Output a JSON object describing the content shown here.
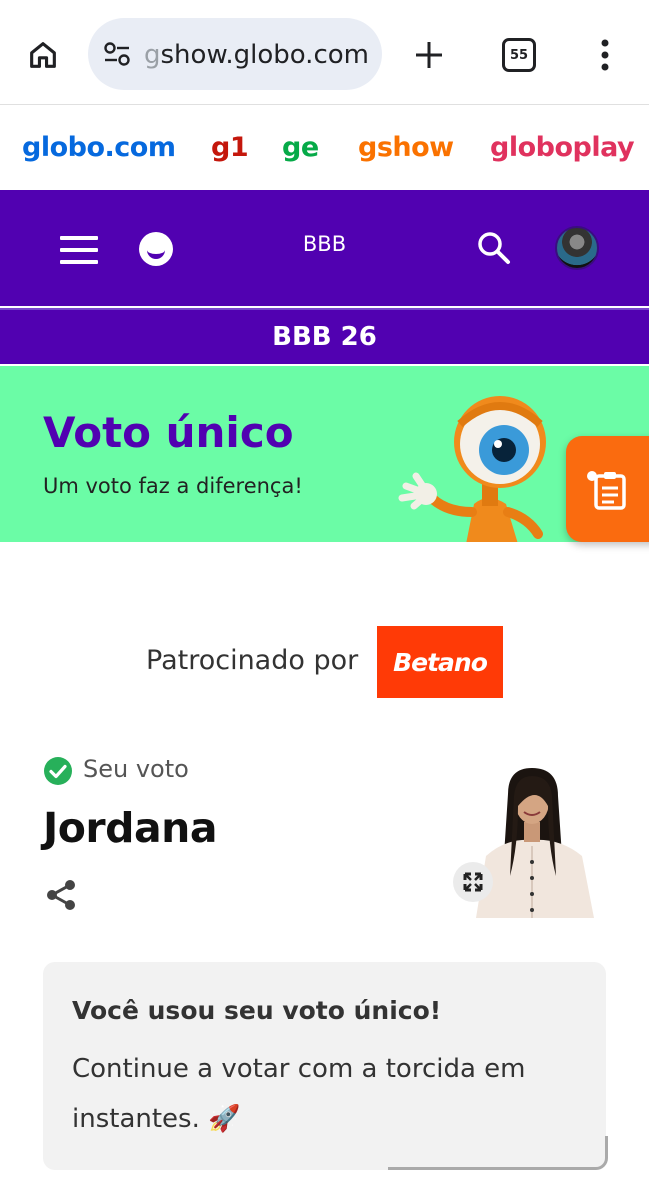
{
  "browser": {
    "url_faded": "g",
    "url": "show.globo.com",
    "tab_count": "55",
    "icons": [
      "home-icon",
      "site-settings-icon",
      "plus-icon",
      "tabs-icon",
      "more-vert-icon"
    ]
  },
  "globo_nav": {
    "items": [
      "globo.com",
      "g1",
      "ge",
      "gshow",
      "globoplay"
    ],
    "colors": [
      "#0669de",
      "#c4170c",
      "#06aa48",
      "#fa7200",
      "#e0325e"
    ]
  },
  "header": {
    "title": "BBB",
    "subtitle": "BBB 26",
    "background": "#5101b1"
  },
  "banner": {
    "title": "Voto único",
    "subtitle": "Um voto faz a diferença!",
    "background": "#6bfca6"
  },
  "sponsor": {
    "label": "Patrocinado por",
    "brand": "Betano",
    "brand_color": "#ff3a06"
  },
  "vote": {
    "label": "Seu voto",
    "candidate": "Jordana"
  },
  "message": {
    "title": "Você usou seu voto único!",
    "body": "Continue a votar com a torcida em instantes. 🚀"
  }
}
